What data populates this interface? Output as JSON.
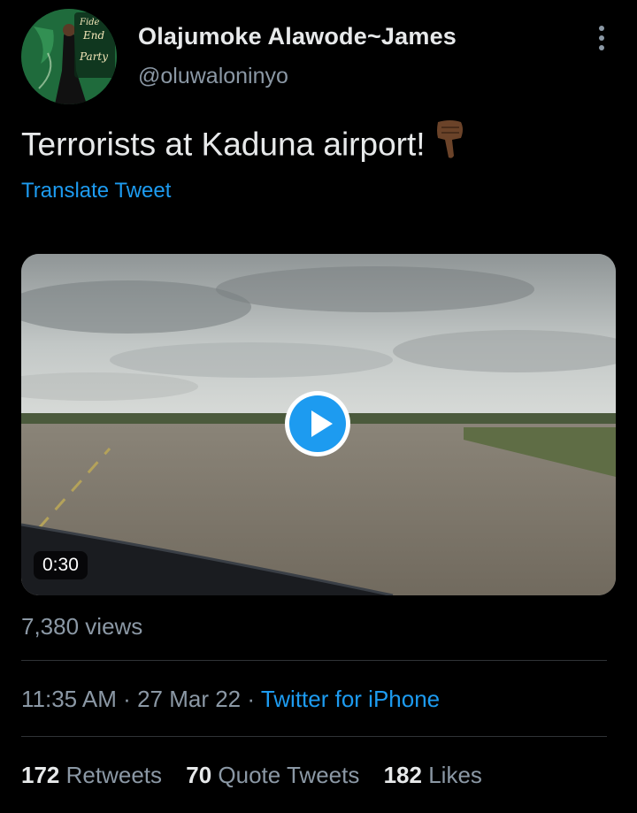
{
  "tweet": {
    "author": {
      "display_name": "Olajumoke Alawode~James",
      "handle": "@oluwaloninyo",
      "avatar_text": [
        "Fide",
        "End",
        "Party"
      ]
    },
    "text": "Terrorists at Kaduna airport!",
    "emoji": "backhand-index-pointing-down-icon",
    "translate_label": "Translate Tweet",
    "media": {
      "duration": "0:30"
    },
    "views": "7,380 views",
    "meta": {
      "time": "11:35 AM",
      "separator": "·",
      "date": "27 Mar 22",
      "source": "Twitter for iPhone"
    },
    "stats": {
      "retweets_count": "172",
      "retweets_label": "Retweets",
      "quotes_count": "70",
      "quotes_label": "Quote Tweets",
      "likes_count": "182",
      "likes_label": "Likes"
    }
  },
  "colors": {
    "background": "#000000",
    "primary_text": "#e7e9ea",
    "secondary_text": "#8b98a5",
    "link": "#1d9bf0",
    "divider": "#2f3336"
  }
}
